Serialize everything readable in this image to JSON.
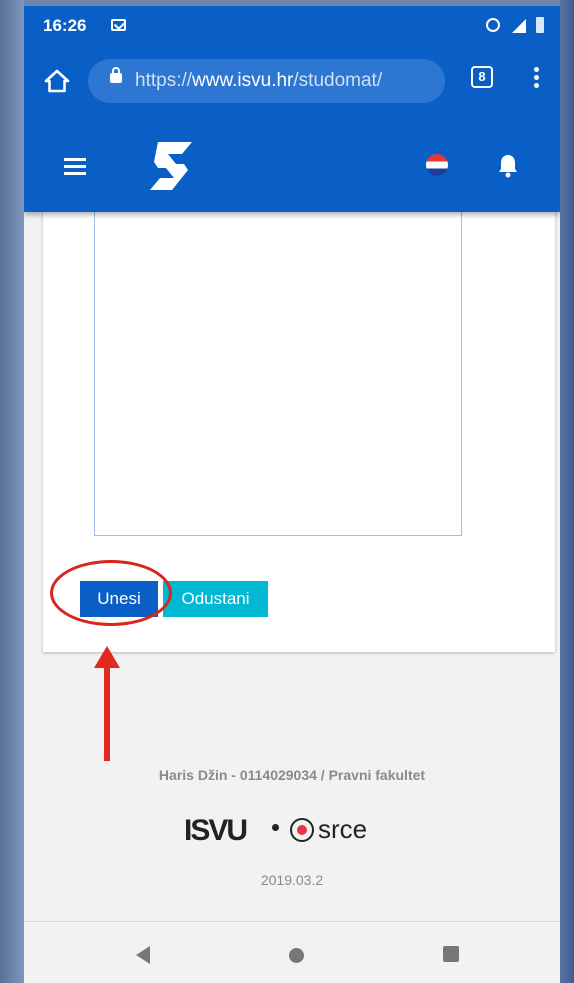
{
  "status_bar": {
    "time": "16:26",
    "icons": [
      "gmail-icon",
      "alarm-icon",
      "signal-icon",
      "battery-icon"
    ]
  },
  "browser": {
    "url_scheme": "https://",
    "url_host": "www.isvu.hr",
    "url_path": "/studomat/",
    "tab_count": "8",
    "icons": [
      "home-icon",
      "lock-icon",
      "tabs-icon",
      "menu-icon"
    ]
  },
  "app_bar": {
    "icons": [
      "hamburger-icon",
      "isvu-logo-icon",
      "croatia-flag-icon",
      "bell-icon"
    ],
    "color": "#0a5fc7"
  },
  "form": {
    "submit_label": "Unesi",
    "cancel_label": "Odustani",
    "submit_color": "#0a5fc7",
    "cancel_color": "#00b8d4"
  },
  "annotation": {
    "highlight_color": "#d9251c",
    "targets": "submit-button"
  },
  "footer": {
    "user_info": "Haris Džin - 0114029034 / Pravni fakultet",
    "isvu_logo": "ISVU",
    "srce_logo": "srce",
    "version": "2019.03.2"
  },
  "nav_bar": {
    "icons": [
      "back-icon",
      "home-icon",
      "recents-icon"
    ]
  }
}
